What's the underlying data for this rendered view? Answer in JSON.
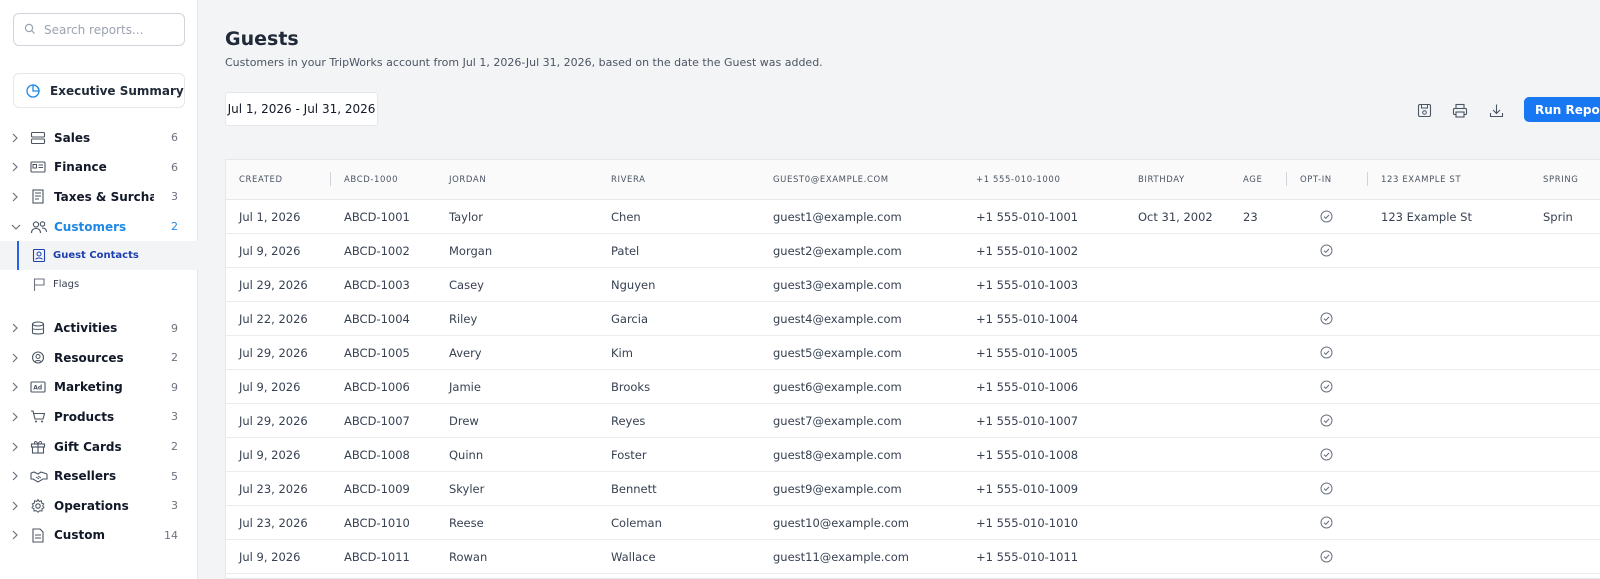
{
  "search": {
    "placeholder": "Search reports..."
  },
  "executive_summary": {
    "label": "Executive Summary"
  },
  "nav": {
    "items": [
      {
        "label": "Sales",
        "count": "6",
        "icon": "stack-icon"
      },
      {
        "label": "Finance",
        "count": "6",
        "icon": "id-card-icon"
      },
      {
        "label": "Taxes & Surcha...",
        "count": "3",
        "icon": "receipt-icon"
      },
      {
        "label": "Customers",
        "count": "2",
        "icon": "users-icon",
        "expanded": true
      },
      {
        "label": "Activities",
        "count": "9",
        "icon": "database-icon"
      },
      {
        "label": "Resources",
        "count": "2",
        "icon": "resource-icon"
      },
      {
        "label": "Marketing",
        "count": "9",
        "icon": "ad-icon"
      },
      {
        "label": "Products",
        "count": "3",
        "icon": "cart-icon"
      },
      {
        "label": "Gift Cards",
        "count": "2",
        "icon": "gift-icon"
      },
      {
        "label": "Resellers",
        "count": "5",
        "icon": "handshake-icon"
      },
      {
        "label": "Operations",
        "count": "3",
        "icon": "gear-icon"
      },
      {
        "label": "Custom",
        "count": "14",
        "icon": "document-icon"
      }
    ],
    "customers_sub": [
      {
        "label": "Guest Contacts",
        "active": true,
        "icon": "contact-icon"
      },
      {
        "label": "Flags",
        "active": false,
        "icon": "flag-icon"
      }
    ]
  },
  "page": {
    "title": "Guests",
    "subtitle": "Customers in your TripWorks account from Jul 1, 2026-Jul 31, 2026, based on the date the Guest was added.",
    "date_range": "Jul 1, 2026 - Jul 31, 2026",
    "run_label": "Run Report"
  },
  "colors": {
    "accent": "#1877f2",
    "active_nav": "#1e88e5"
  },
  "table": {
    "columns": [
      "Created",
      "ABCD-1000",
      "JORDAN",
      "RIVERA",
      "GUEST0@EXAMPLE.COM",
      "+1 555-010-1000",
      "BIRTHDAY",
      "AGE",
      "OPT-IN",
      "123 EXAMPLE ST",
      "SPRING"
    ],
    "rows": [
      {
        "created": "Jul 1, 2026",
        "id": "ABCD-1001",
        "first": "Taylor",
        "last": "Chen",
        "email": "guest1@example.com",
        "phone": "+1 555-010-1001",
        "birthday": "Oct 31, 2002",
        "age": "23",
        "optin": true,
        "address": "123 Example St",
        "city": "Sprin"
      },
      {
        "created": "Jul 9, 2026",
        "id": "ABCD-1002",
        "first": "Morgan",
        "last": "Patel",
        "email": "guest2@example.com",
        "phone": "+1 555-010-1002",
        "birthday": "",
        "age": "",
        "optin": true,
        "address": "",
        "city": ""
      },
      {
        "created": "Jul 29, 2026",
        "id": "ABCD-1003",
        "first": "Casey",
        "last": "Nguyen",
        "email": "guest3@example.com",
        "phone": "+1 555-010-1003",
        "birthday": "",
        "age": "",
        "optin": false,
        "address": "",
        "city": ""
      },
      {
        "created": "Jul 22, 2026",
        "id": "ABCD-1004",
        "first": "Riley",
        "last": "Garcia",
        "email": "guest4@example.com",
        "phone": "+1 555-010-1004",
        "birthday": "",
        "age": "",
        "optin": true,
        "address": "",
        "city": ""
      },
      {
        "created": "Jul 29, 2026",
        "id": "ABCD-1005",
        "first": "Avery",
        "last": "Kim",
        "email": "guest5@example.com",
        "phone": "+1 555-010-1005",
        "birthday": "",
        "age": "",
        "optin": true,
        "address": "",
        "city": ""
      },
      {
        "created": "Jul 9, 2026",
        "id": "ABCD-1006",
        "first": "Jamie",
        "last": "Brooks",
        "email": "guest6@example.com",
        "phone": "+1 555-010-1006",
        "birthday": "",
        "age": "",
        "optin": true,
        "address": "",
        "city": ""
      },
      {
        "created": "Jul 29, 2026",
        "id": "ABCD-1007",
        "first": "Drew",
        "last": "Reyes",
        "email": "guest7@example.com",
        "phone": "+1 555-010-1007",
        "birthday": "",
        "age": "",
        "optin": true,
        "address": "",
        "city": ""
      },
      {
        "created": "Jul 9, 2026",
        "id": "ABCD-1008",
        "first": "Quinn",
        "last": "Foster",
        "email": "guest8@example.com",
        "phone": "+1 555-010-1008",
        "birthday": "",
        "age": "",
        "optin": true,
        "address": "",
        "city": ""
      },
      {
        "created": "Jul 23, 2026",
        "id": "ABCD-1009",
        "first": "Skyler",
        "last": "Bennett",
        "email": "guest9@example.com",
        "phone": "+1 555-010-1009",
        "birthday": "",
        "age": "",
        "optin": true,
        "address": "",
        "city": ""
      },
      {
        "created": "Jul 23, 2026",
        "id": "ABCD-1010",
        "first": "Reese",
        "last": "Coleman",
        "email": "guest10@example.com",
        "phone": "+1 555-010-1010",
        "birthday": "",
        "age": "",
        "optin": true,
        "address": "",
        "city": ""
      },
      {
        "created": "Jul 9, 2026",
        "id": "ABCD-1011",
        "first": "Rowan",
        "last": "Wallace",
        "email": "guest11@example.com",
        "phone": "+1 555-010-1011",
        "birthday": "",
        "age": "",
        "optin": true,
        "address": "",
        "city": ""
      }
    ]
  }
}
